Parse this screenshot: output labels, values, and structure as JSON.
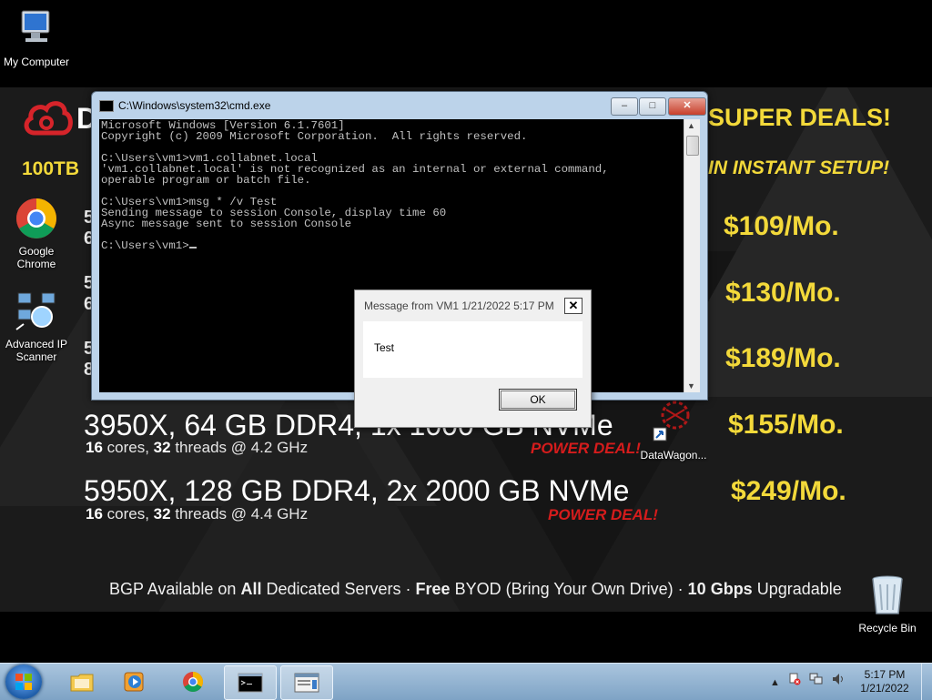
{
  "desktop": {
    "icons": [
      {
        "label": "My Computer"
      },
      {
        "label": "Google Chrome"
      },
      {
        "label": "Advanced IP Scanner"
      },
      {
        "label": "DataWagon..."
      },
      {
        "label": "Recycle Bin"
      }
    ]
  },
  "wallpaper": {
    "logo_letter": "D",
    "headline": "SUPER DEALS!",
    "subheadline": "IN INSTANT SETUP!",
    "left_label": "100TB",
    "cut_chars": [
      "5",
      "6",
      "5",
      "6",
      "5",
      "8"
    ],
    "prices": [
      "$109/Mo.",
      "$130/Mo.",
      "$189/Mo.",
      "$155/Mo.",
      "$249/Mo."
    ],
    "servers": [
      {
        "spec": "3950X, 64 GB DDR4, 1x 1000 GB NVMe",
        "cores": "16",
        "cores_label": " cores, ",
        "threads": "32",
        "threads_label": " threads @ 4.2 GHz",
        "tag": "POWER DEAL!"
      },
      {
        "spec": "5950X, 128 GB DDR4, 2x 2000 GB NVMe",
        "cores": "16",
        "cores_label": " cores, ",
        "threads": "32",
        "threads_label": " threads @ 4.4 GHz",
        "tag": "POWER DEAL!"
      }
    ],
    "bgp": {
      "p1": "BGP Available on ",
      "b1": "All",
      "p2": " Dedicated Servers · ",
      "b2": "Free",
      "p3": " BYOD (Bring Your Own Drive) · ",
      "b3": "10 Gbps",
      "p4": " Upgradable"
    },
    "colors": {
      "accent": "#f3d93a",
      "power": "#d51c1c"
    }
  },
  "cmd": {
    "title": "C:\\Windows\\system32\\cmd.exe",
    "lines": "Microsoft Windows [Version 6.1.7601]\nCopyright (c) 2009 Microsoft Corporation.  All rights reserved.\n\nC:\\Users\\vm1>vm1.collabnet.local\n'vm1.collabnet.local' is not recognized as an internal or external command,\noperable program or batch file.\n\nC:\\Users\\vm1>msg * /v Test\nSending message to session Console, display time 60\nAsync message sent to session Console\n\nC:\\Users\\vm1>",
    "buttons": {
      "minimize": "‒",
      "maximize": "□",
      "close": "✕"
    }
  },
  "message_box": {
    "title": "Message from VM1 1/21/2022 5:17 PM",
    "body": "Test",
    "ok_label": "OK",
    "close_label": "✕"
  },
  "taskbar": {
    "pinned": [
      "explorer-icon",
      "media-player-icon",
      "chrome-icon",
      "cmd-icon",
      "message-window-icon"
    ],
    "clock_time": "5:17 PM",
    "clock_date": "1/21/2022",
    "tray_arrow": "▲"
  }
}
